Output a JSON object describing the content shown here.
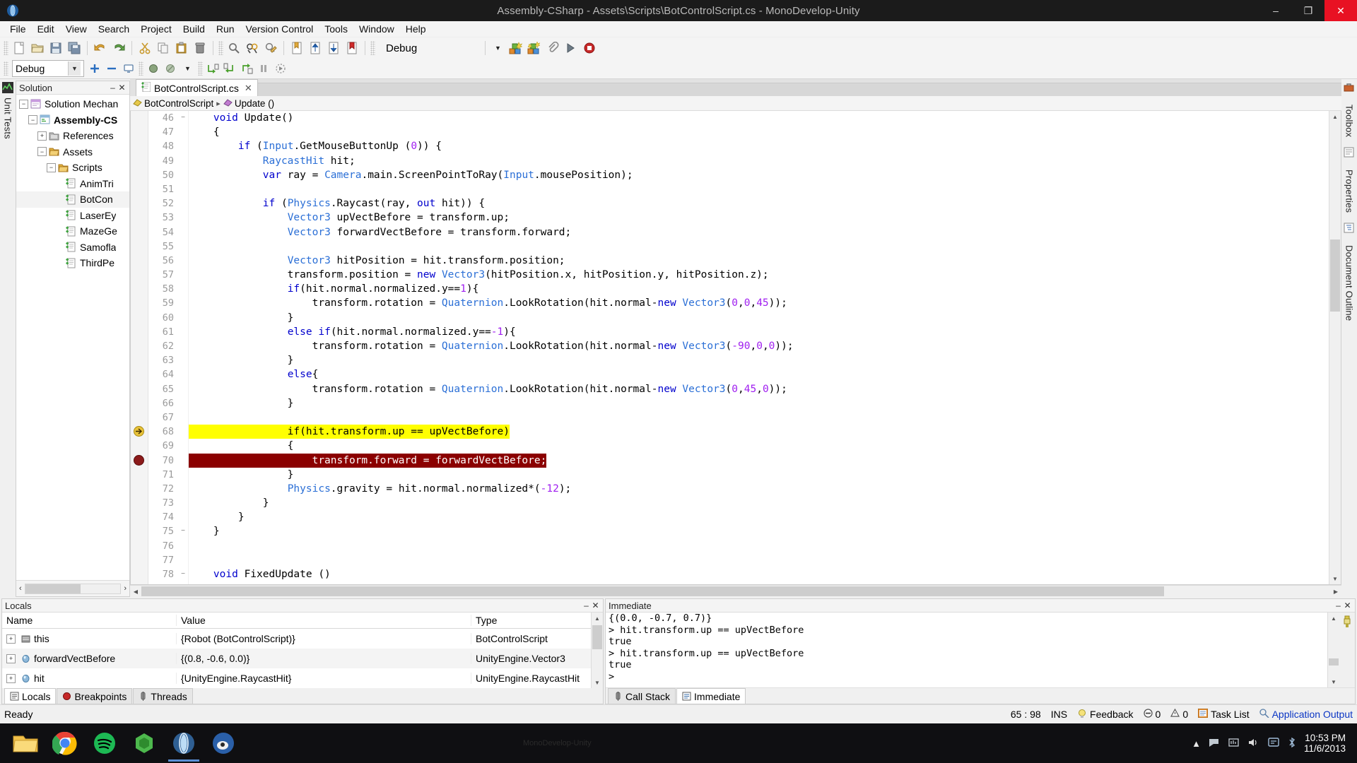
{
  "window": {
    "title": "Assembly-CSharp - Assets\\Scripts\\BotControlScript.cs - MonoDevelop-Unity",
    "minimize": "–",
    "maximize": "❐",
    "close": "✕"
  },
  "menubar": {
    "items": [
      "File",
      "Edit",
      "View",
      "Search",
      "Project",
      "Build",
      "Run",
      "Version Control",
      "Tools",
      "Window",
      "Help"
    ]
  },
  "toolbar1": {
    "buttons": [
      "new-file-icon",
      "open-file-icon",
      "save-icon",
      "save-all-icon",
      "undo-icon",
      "redo-icon",
      "cut-icon",
      "copy-icon",
      "paste-icon",
      "delete-icon",
      "find-icon",
      "find-replace-icon",
      "find-in-files-icon",
      "bookmark-toggle-icon",
      "bookmark-prev-icon",
      "bookmark-next-icon",
      "bookmark-clear-icon"
    ],
    "configuration": "Debug",
    "run_buttons": [
      "build-icon",
      "rebuild-icon",
      "attach-icon",
      "run-icon",
      "stop-icon"
    ]
  },
  "toolbar2": {
    "debug_target": "Debug",
    "buttons": [
      "add-icon",
      "remove-icon",
      "screen-icon",
      "breakpoint-icon",
      "breakpoints-disable-icon",
      "step-over-icon",
      "step-into-icon",
      "step-out-icon",
      "pause-icon",
      "continue-icon"
    ]
  },
  "left_dock": {
    "unit_tests_label": "Unit Tests",
    "unit_tests_icon": "unit-tests-icon"
  },
  "right_dock": {
    "items": [
      {
        "label": "Toolbox",
        "icon": "toolbox-icon"
      },
      {
        "label": "Properties",
        "icon": "properties-icon"
      },
      {
        "label": "Document Outline",
        "icon": "document-outline-icon"
      }
    ]
  },
  "solution_pad": {
    "title": "Solution",
    "minimize": "–",
    "close": "✕",
    "tree": [
      {
        "label": "Solution Mechan",
        "indent": 0,
        "expander": "−",
        "icon": "solution-icon",
        "bold": false,
        "selected": false
      },
      {
        "label": "Assembly-CS",
        "indent": 1,
        "expander": "−",
        "icon": "project-icon",
        "bold": true,
        "selected": false
      },
      {
        "label": "References",
        "indent": 2,
        "expander": "+",
        "icon": "references-icon",
        "bold": false,
        "selected": false
      },
      {
        "label": "Assets",
        "indent": 2,
        "expander": "−",
        "icon": "folder-icon",
        "bold": false,
        "selected": false
      },
      {
        "label": "Scripts",
        "indent": 3,
        "expander": "−",
        "icon": "folder-icon",
        "bold": false,
        "selected": false
      },
      {
        "label": "AnimTri",
        "indent": 4,
        "expander": "",
        "icon": "csharp-file-icon",
        "bold": false,
        "selected": false
      },
      {
        "label": "BotCon",
        "indent": 4,
        "expander": "",
        "icon": "csharp-file-icon",
        "bold": false,
        "selected": true
      },
      {
        "label": "LaserEy",
        "indent": 4,
        "expander": "",
        "icon": "csharp-file-icon",
        "bold": false,
        "selected": false
      },
      {
        "label": "MazeGe",
        "indent": 4,
        "expander": "",
        "icon": "csharp-file-icon",
        "bold": false,
        "selected": false
      },
      {
        "label": "Samofla",
        "indent": 4,
        "expander": "",
        "icon": "csharp-file-icon",
        "bold": false,
        "selected": false
      },
      {
        "label": "ThirdPe",
        "indent": 4,
        "expander": "",
        "icon": "csharp-file-icon",
        "bold": false,
        "selected": false
      }
    ]
  },
  "editor": {
    "tab": {
      "label": "BotControlScript.cs",
      "icon": "csharp-file-icon",
      "close": "✕"
    },
    "breadcrumb": [
      {
        "label": "BotControlScript",
        "icon": "class-icon"
      },
      {
        "label": "Update ()",
        "icon": "method-icon"
      }
    ],
    "breadcrumb_separator": "▸",
    "first_line": 46,
    "lines": [
      {
        "n": 46,
        "text": "    void Update()",
        "fold": "−"
      },
      {
        "n": 47,
        "text": "    {"
      },
      {
        "n": 48,
        "text": "        if (Input.GetMouseButtonUp (0)) {"
      },
      {
        "n": 49,
        "text": "            RaycastHit hit;"
      },
      {
        "n": 50,
        "text": "            var ray = Camera.main.ScreenPointToRay(Input.mousePosition);"
      },
      {
        "n": 51,
        "text": ""
      },
      {
        "n": 52,
        "text": "            if (Physics.Raycast(ray, out hit)) {"
      },
      {
        "n": 53,
        "text": "                Vector3 upVectBefore = transform.up;"
      },
      {
        "n": 54,
        "text": "                Vector3 forwardVectBefore = transform.forward;"
      },
      {
        "n": 55,
        "text": ""
      },
      {
        "n": 56,
        "text": "                Vector3 hitPosition = hit.transform.position;"
      },
      {
        "n": 57,
        "text": "                transform.position = new Vector3(hitPosition.x, hitPosition.y, hitPosition.z);"
      },
      {
        "n": 58,
        "text": "                if(hit.normal.normalized.y==1){"
      },
      {
        "n": 59,
        "text": "                    transform.rotation = Quaternion.LookRotation(hit.normal-new Vector3(0,0,45));"
      },
      {
        "n": 60,
        "text": "                }"
      },
      {
        "n": 61,
        "text": "                else if(hit.normal.normalized.y==-1){"
      },
      {
        "n": 62,
        "text": "                    transform.rotation = Quaternion.LookRotation(hit.normal-new Vector3(-90,0,0));"
      },
      {
        "n": 63,
        "text": "                }"
      },
      {
        "n": 64,
        "text": "                else{"
      },
      {
        "n": 65,
        "text": "                    transform.rotation = Quaternion.LookRotation(hit.normal-new Vector3(0,45,0));"
      },
      {
        "n": 66,
        "text": "                }"
      },
      {
        "n": 67,
        "text": ""
      },
      {
        "n": 68,
        "text": "                if(hit.transform.up == upVectBefore)",
        "highlight": "current-line",
        "marker": "execution-arrow"
      },
      {
        "n": 69,
        "text": "                {"
      },
      {
        "n": 70,
        "text": "                    transform.forward = forwardVectBefore;",
        "highlight": "breakpoint-line",
        "marker": "breakpoint"
      },
      {
        "n": 71,
        "text": "                }"
      },
      {
        "n": 72,
        "text": "                Physics.gravity = hit.normal.normalized*(-12);"
      },
      {
        "n": 73,
        "text": "            }"
      },
      {
        "n": 74,
        "text": "        }"
      },
      {
        "n": 75,
        "text": "    }",
        "fold": "−"
      },
      {
        "n": 76,
        "text": ""
      },
      {
        "n": 77,
        "text": ""
      },
      {
        "n": 78,
        "text": "    void FixedUpdate ()",
        "fold": "−"
      }
    ]
  },
  "locals_pad": {
    "title": "Locals",
    "minimize": "–",
    "close": "✕",
    "columns": [
      "Name",
      "Value",
      "Type"
    ],
    "rows": [
      {
        "expander": "+",
        "icon": "object-icon",
        "name": "this",
        "value": "{Robot (BotControlScript)}",
        "type": "BotControlScript"
      },
      {
        "expander": "+",
        "icon": "struct-icon",
        "name": "forwardVectBefore",
        "value": "{(0.8, -0.6, 0.0)}",
        "type": "UnityEngine.Vector3"
      },
      {
        "expander": "+",
        "icon": "struct-icon",
        "name": "hit",
        "value": "{UnityEngine.RaycastHit}",
        "type": "UnityEngine.RaycastHit"
      }
    ],
    "tabs": [
      {
        "label": "Locals",
        "icon": "locals-icon",
        "active": true
      },
      {
        "label": "Breakpoints",
        "icon": "breakpoint-icon",
        "active": false
      },
      {
        "label": "Threads",
        "icon": "threads-icon",
        "active": false
      }
    ]
  },
  "immediate_pad": {
    "title": "Immediate",
    "minimize": "–",
    "close": "✕",
    "lines": [
      "{(0.0, -0.7, 0.7)}",
      "> hit.transform.up == upVectBefore",
      "true",
      "> hit.transform.up == upVectBefore",
      "true",
      ">"
    ],
    "tabs": [
      {
        "label": "Call Stack",
        "icon": "call-stack-icon",
        "active": false
      },
      {
        "label": "Immediate",
        "icon": "immediate-icon",
        "active": true
      }
    ],
    "clear_icon": "clear-pad-icon"
  },
  "statusbar": {
    "ready": "Ready",
    "caret": "65 : 98",
    "insert_mode": "INS",
    "feedback": "Feedback",
    "feedback_icon": "feedback-icon",
    "error_count": "0",
    "warning_count": "0",
    "error_icon": "error-icon",
    "warning_icon": "warning-icon",
    "task_list": "Task List",
    "task_list_icon": "task-list-icon",
    "application_output": "Application Output",
    "application_output_icon": "application-output-icon"
  },
  "taskbar": {
    "items": [
      {
        "name": "file-explorer-icon",
        "active": false
      },
      {
        "name": "google-chrome-icon",
        "active": false
      },
      {
        "name": "spotify-icon",
        "active": false
      },
      {
        "name": "unity-icon",
        "active": false
      },
      {
        "name": "monodevelop-icon",
        "active": true
      },
      {
        "name": "blender-icon",
        "active": false
      }
    ],
    "ghost_text": "MonoDevelop-Unity",
    "tray": {
      "show_hidden_icon": "chevron-up-icon",
      "icons": [
        "network-flag-icon",
        "onedrive-icon",
        "volume-icon",
        "action-center-icon",
        "bluetooth-icon"
      ],
      "time": "10:53 PM",
      "date": "11/6/2013"
    }
  },
  "colors": {
    "title_bar": "#1b1b1b",
    "close_button": "#e81123",
    "current_line": "#ffff00",
    "breakpoint_line": "#8b0000",
    "keyword": "#0000cd",
    "type": "#2b6fd6",
    "number": "#a020f0",
    "link": "#0a35c4"
  }
}
